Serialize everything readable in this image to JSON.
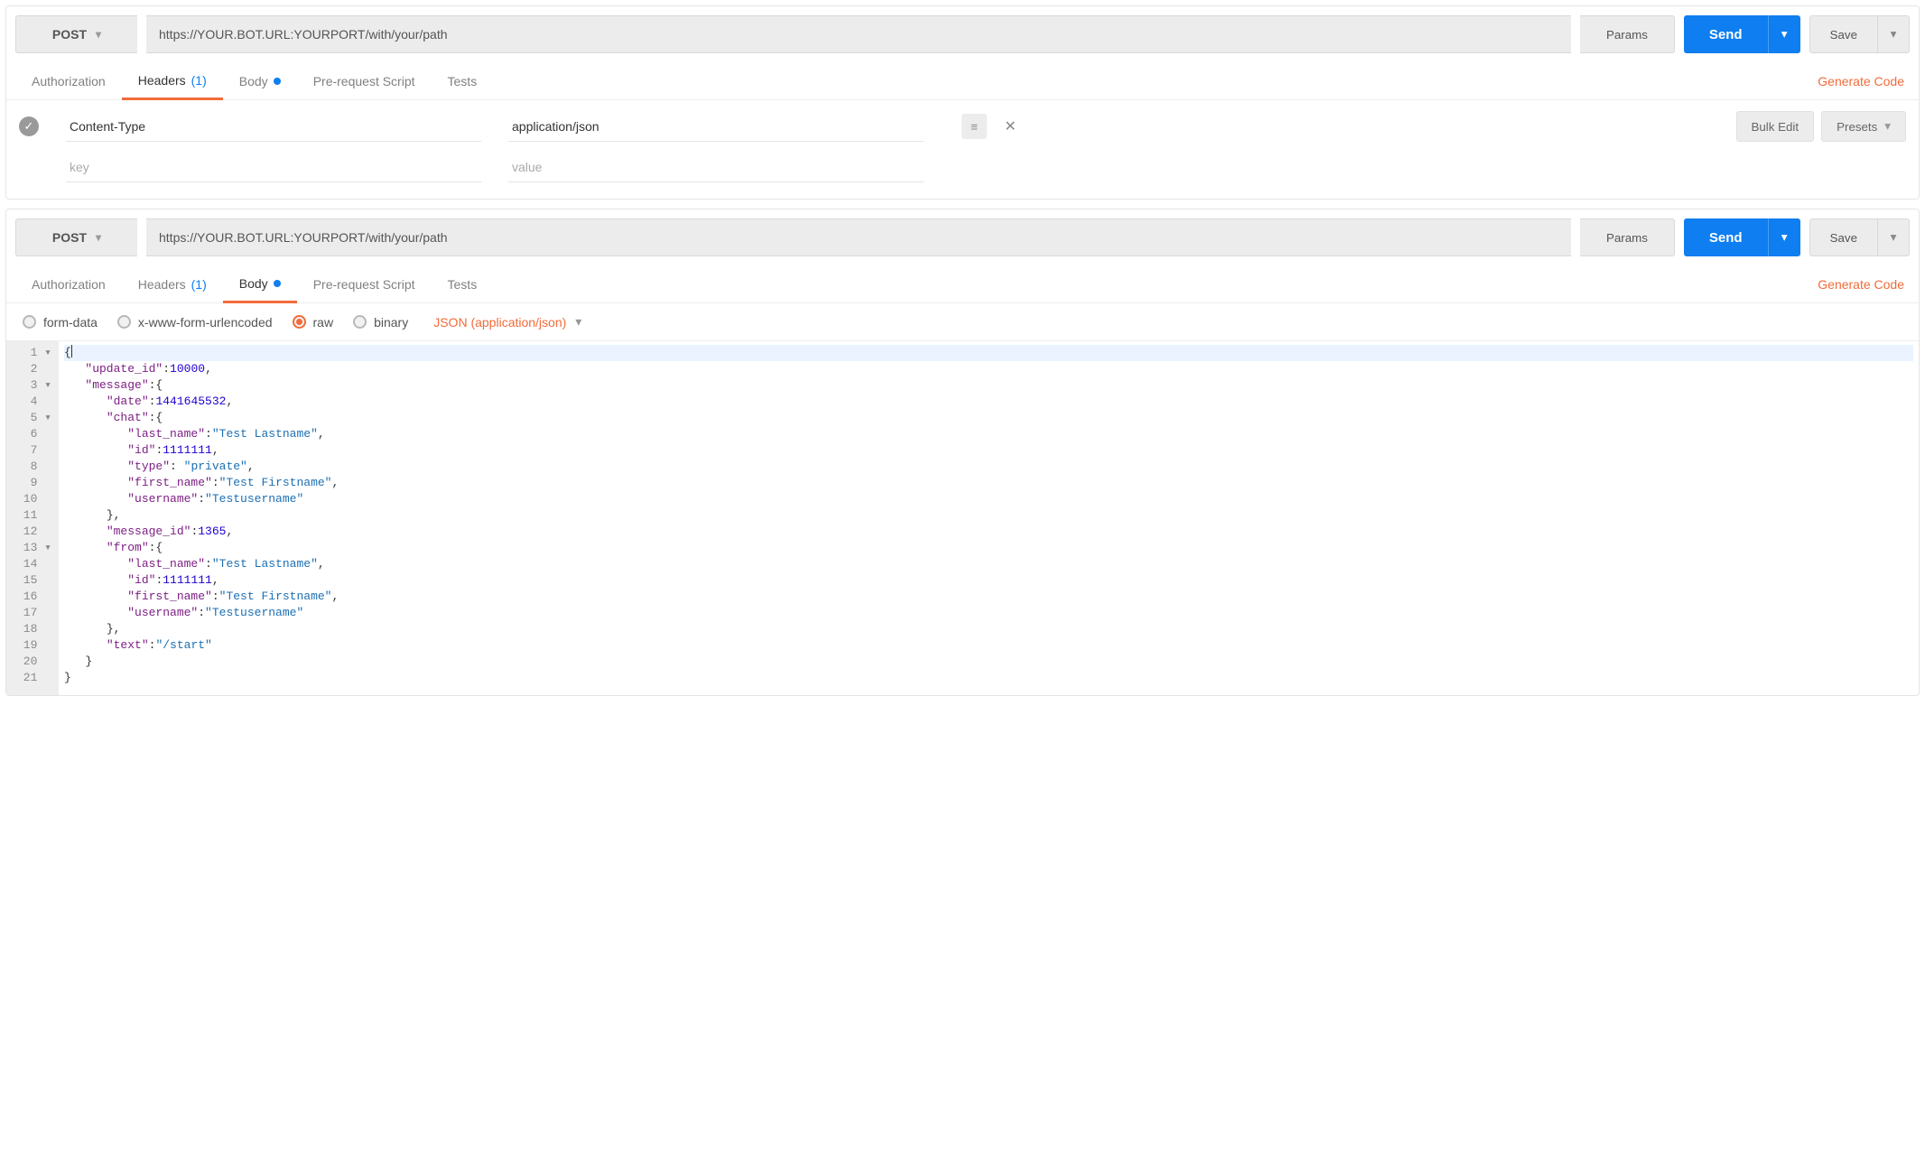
{
  "req1": {
    "method": "POST",
    "url": "https://YOUR.BOT.URL:YOURPORT/with/your/path",
    "params_label": "Params",
    "send_label": "Send",
    "save_label": "Save",
    "tabs": {
      "auth": "Authorization",
      "headers": "Headers",
      "headers_count": "(1)",
      "body": "Body",
      "prs": "Pre-request Script",
      "tests": "Tests"
    },
    "gen_code": "Generate Code",
    "header_row": {
      "key": "Content-Type",
      "value": "application/json"
    },
    "key_ph": "key",
    "val_ph": "value",
    "bulk_edit": "Bulk Edit",
    "presets": "Presets"
  },
  "req2": {
    "method": "POST",
    "url": "https://YOUR.BOT.URL:YOURPORT/with/your/path",
    "params_label": "Params",
    "send_label": "Send",
    "save_label": "Save",
    "tabs": {
      "auth": "Authorization",
      "headers": "Headers",
      "headers_count": "(1)",
      "body": "Body",
      "prs": "Pre-request Script",
      "tests": "Tests"
    },
    "gen_code": "Generate Code",
    "body_types": {
      "form": "form-data",
      "xwww": "x-www-form-urlencoded",
      "raw": "raw",
      "binary": "binary"
    },
    "content_type": "JSON (application/json)",
    "code_lines": [
      {
        "n": "1",
        "fold": "▾",
        "hl": true,
        "seg": [
          {
            "c": "punc",
            "t": "{"
          }
        ]
      },
      {
        "n": "2",
        "seg": [
          {
            "t": "   "
          },
          {
            "c": "key",
            "t": "\"update_id\""
          },
          {
            "c": "punc",
            "t": ":"
          },
          {
            "c": "num",
            "t": "10000"
          },
          {
            "c": "punc",
            "t": ","
          }
        ]
      },
      {
        "n": "3",
        "fold": "▾",
        "seg": [
          {
            "t": "   "
          },
          {
            "c": "key",
            "t": "\"message\""
          },
          {
            "c": "punc",
            "t": ":{"
          }
        ]
      },
      {
        "n": "4",
        "seg": [
          {
            "t": "      "
          },
          {
            "c": "key",
            "t": "\"date\""
          },
          {
            "c": "punc",
            "t": ":"
          },
          {
            "c": "num",
            "t": "1441645532"
          },
          {
            "c": "punc",
            "t": ","
          }
        ]
      },
      {
        "n": "5",
        "fold": "▾",
        "seg": [
          {
            "t": "      "
          },
          {
            "c": "key",
            "t": "\"chat\""
          },
          {
            "c": "punc",
            "t": ":{"
          }
        ]
      },
      {
        "n": "6",
        "seg": [
          {
            "t": "         "
          },
          {
            "c": "key",
            "t": "\"last_name\""
          },
          {
            "c": "punc",
            "t": ":"
          },
          {
            "c": "str",
            "t": "\"Test Lastname\""
          },
          {
            "c": "punc",
            "t": ","
          }
        ]
      },
      {
        "n": "7",
        "seg": [
          {
            "t": "         "
          },
          {
            "c": "key",
            "t": "\"id\""
          },
          {
            "c": "punc",
            "t": ":"
          },
          {
            "c": "num",
            "t": "1111111"
          },
          {
            "c": "punc",
            "t": ","
          }
        ]
      },
      {
        "n": "8",
        "seg": [
          {
            "t": "         "
          },
          {
            "c": "key",
            "t": "\"type\""
          },
          {
            "c": "punc",
            "t": ": "
          },
          {
            "c": "str",
            "t": "\"private\""
          },
          {
            "c": "punc",
            "t": ","
          }
        ]
      },
      {
        "n": "9",
        "seg": [
          {
            "t": "         "
          },
          {
            "c": "key",
            "t": "\"first_name\""
          },
          {
            "c": "punc",
            "t": ":"
          },
          {
            "c": "str",
            "t": "\"Test Firstname\""
          },
          {
            "c": "punc",
            "t": ","
          }
        ]
      },
      {
        "n": "10",
        "seg": [
          {
            "t": "         "
          },
          {
            "c": "key",
            "t": "\"username\""
          },
          {
            "c": "punc",
            "t": ":"
          },
          {
            "c": "str",
            "t": "\"Testusername\""
          }
        ]
      },
      {
        "n": "11",
        "seg": [
          {
            "t": "      "
          },
          {
            "c": "punc",
            "t": "},"
          }
        ]
      },
      {
        "n": "12",
        "seg": [
          {
            "t": "      "
          },
          {
            "c": "key",
            "t": "\"message_id\""
          },
          {
            "c": "punc",
            "t": ":"
          },
          {
            "c": "num",
            "t": "1365"
          },
          {
            "c": "punc",
            "t": ","
          }
        ]
      },
      {
        "n": "13",
        "fold": "▾",
        "seg": [
          {
            "t": "      "
          },
          {
            "c": "key",
            "t": "\"from\""
          },
          {
            "c": "punc",
            "t": ":{"
          }
        ]
      },
      {
        "n": "14",
        "seg": [
          {
            "t": "         "
          },
          {
            "c": "key",
            "t": "\"last_name\""
          },
          {
            "c": "punc",
            "t": ":"
          },
          {
            "c": "str",
            "t": "\"Test Lastname\""
          },
          {
            "c": "punc",
            "t": ","
          }
        ]
      },
      {
        "n": "15",
        "seg": [
          {
            "t": "         "
          },
          {
            "c": "key",
            "t": "\"id\""
          },
          {
            "c": "punc",
            "t": ":"
          },
          {
            "c": "num",
            "t": "1111111"
          },
          {
            "c": "punc",
            "t": ","
          }
        ]
      },
      {
        "n": "16",
        "seg": [
          {
            "t": "         "
          },
          {
            "c": "key",
            "t": "\"first_name\""
          },
          {
            "c": "punc",
            "t": ":"
          },
          {
            "c": "str",
            "t": "\"Test Firstname\""
          },
          {
            "c": "punc",
            "t": ","
          }
        ]
      },
      {
        "n": "17",
        "seg": [
          {
            "t": "         "
          },
          {
            "c": "key",
            "t": "\"username\""
          },
          {
            "c": "punc",
            "t": ":"
          },
          {
            "c": "str",
            "t": "\"Testusername\""
          }
        ]
      },
      {
        "n": "18",
        "seg": [
          {
            "t": "      "
          },
          {
            "c": "punc",
            "t": "},"
          }
        ]
      },
      {
        "n": "19",
        "seg": [
          {
            "t": "      "
          },
          {
            "c": "key",
            "t": "\"text\""
          },
          {
            "c": "punc",
            "t": ":"
          },
          {
            "c": "str",
            "t": "\"/start\""
          }
        ]
      },
      {
        "n": "20",
        "seg": [
          {
            "t": "   "
          },
          {
            "c": "punc",
            "t": "}"
          }
        ]
      },
      {
        "n": "21",
        "seg": [
          {
            "c": "punc",
            "t": "}"
          }
        ]
      }
    ]
  }
}
